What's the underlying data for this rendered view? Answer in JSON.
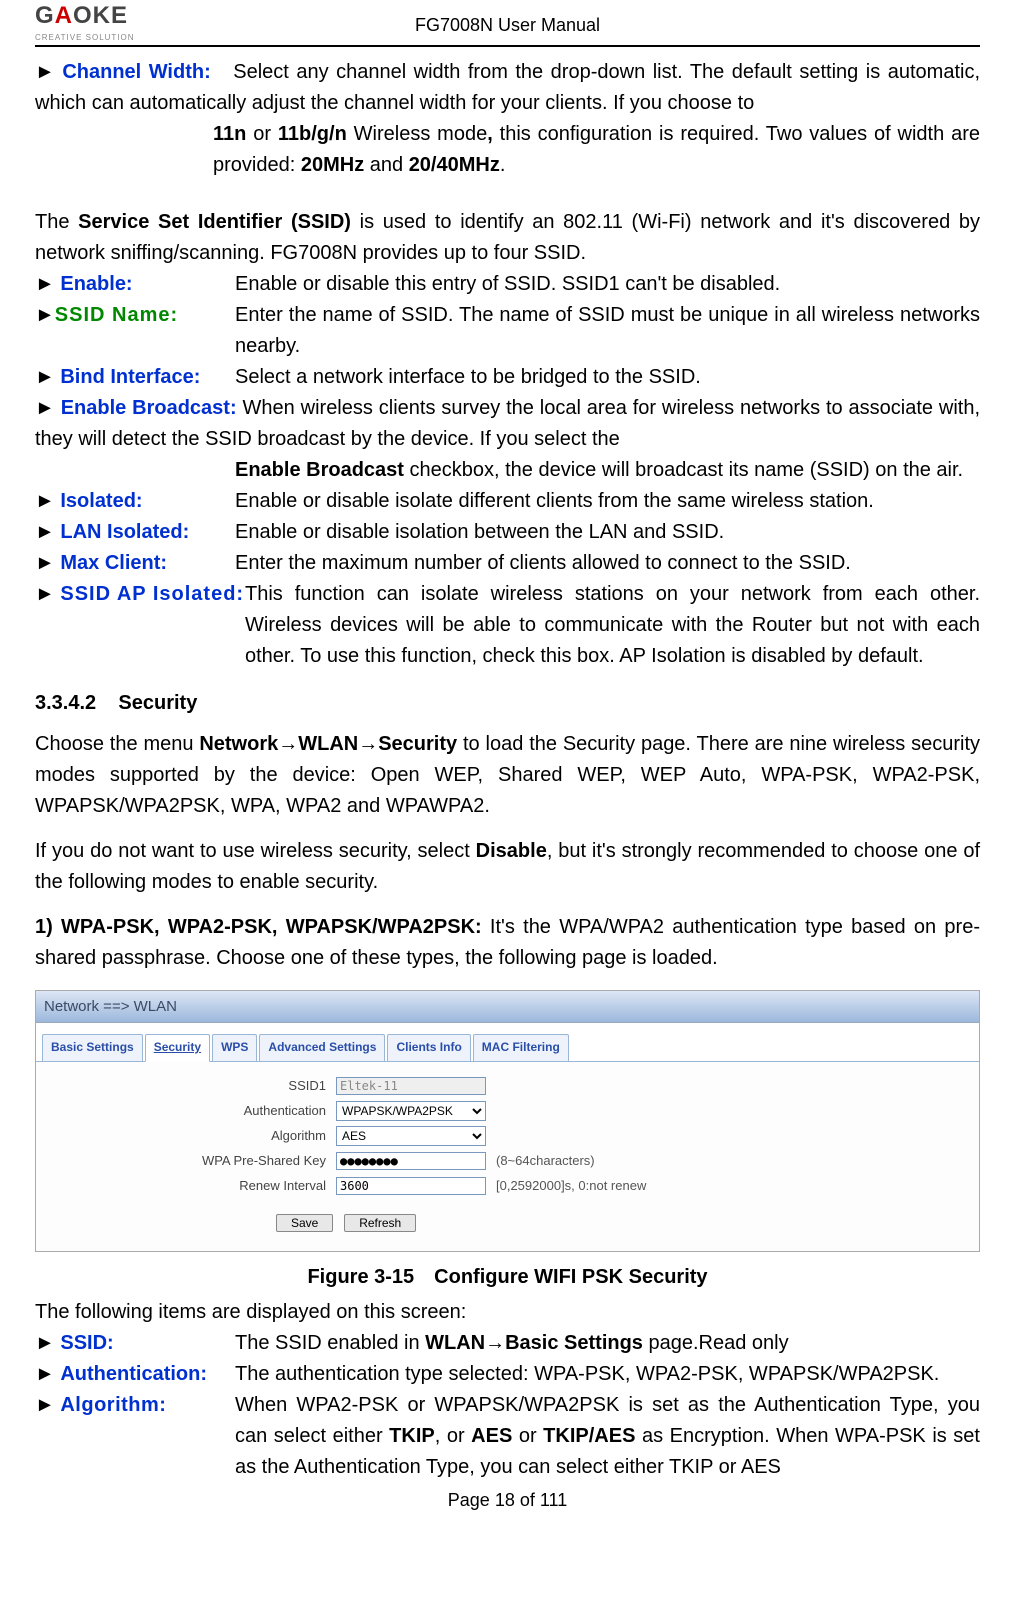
{
  "header": {
    "logo_main_pre": "G",
    "logo_main_o": "A",
    "logo_main_post": "OKE",
    "logo_sub": "CREATIVE SOLUTION",
    "doc_title": "FG7008N User Manual"
  },
  "items": {
    "channel_width": {
      "term": "Channel Width:",
      "p1": "Select any channel width from the drop-down list. The default setting is automatic, which can automatically adjust the channel width for your clients. If you choose to ",
      "bold1": "11n",
      "mid1": " or ",
      "bold2": "11b/g/n",
      "mid2": " Wireless mode",
      "bold_comma": ",",
      "mid3": " this configuration is required. Two values of width are provided: ",
      "bold3": "20MHz",
      "mid4": " and ",
      "bold4": "20/40MHz",
      "tail": "."
    }
  },
  "ssid_intro": {
    "p1": "The ",
    "bold1": "Service Set Identifier (SSID)",
    "p2": " is used to identify an 802.11 (Wi-Fi) network and it's discovered by network sniffing/scanning. FG7008N provides up to four SSID."
  },
  "ssid_items": {
    "enable": {
      "term": "Enable:",
      "desc": "Enable or disable this entry of SSID. SSID1 can't be disabled."
    },
    "ssid_name": {
      "term": "SSID Name:",
      "desc": "Enter the name of SSID. The name of SSID must be unique in all wireless networks nearby."
    },
    "bind_interface": {
      "term": "Bind Interface:",
      "desc": "Select a network interface to be bridged to the SSID."
    },
    "enable_broadcast": {
      "term": "Enable Broadcast:",
      "p1": "When wireless clients survey the local area for wireless networks to associate with, they will detect the SSID broadcast by the device. If you select the ",
      "bold1": "Enable Broadcast",
      "p2": " checkbox, the device will broadcast its name (SSID) on the air."
    },
    "isolated": {
      "term": "Isolated:",
      "desc": "Enable or disable isolate different clients from the same wireless station."
    },
    "lan_isolated": {
      "term": "LAN Isolated:",
      "desc": "Enable or disable isolation between the LAN and SSID."
    },
    "max_client": {
      "term": "Max Client:",
      "desc": "Enter the maximum number of clients allowed to connect to the SSID."
    },
    "ssid_ap_isolated": {
      "term": "SSID AP Isolated:",
      "desc": "This function can isolate wireless stations on your network from each other. Wireless devices will be able to communicate with the Router but not with each other. To use this function, check this box. AP Isolation is disabled by default."
    }
  },
  "section": {
    "num": "3.3.4.2",
    "title": "Security"
  },
  "sec_para1": {
    "p1": "Choose the menu ",
    "bold1": "Network→WLAN→Security",
    "p2": " to load the Security page. There are nine wireless security modes supported by the device: Open WEP, Shared WEP, WEP Auto, WPA-PSK, WPA2-PSK, WPAPSK/WPA2PSK, WPA, WPA2 and WPAWPA2."
  },
  "sec_para2": {
    "p1": "If you do not want to use wireless security, select ",
    "bold1": "Disable",
    "p2": ", but it's strongly recommended to choose one of the following modes to enable security."
  },
  "sec_para3": {
    "bold1": "1) WPA-PSK, WPA2-PSK, WPAPSK/WPA2PSK:",
    "p1": " It's the WPA/WPA2 authentication type based on pre-shared passphrase. Choose one of these types, the following page is loaded."
  },
  "screenshot": {
    "title": "Network ==> WLAN",
    "tabs": [
      "Basic Settings",
      "Security",
      "WPS",
      "Advanced Settings",
      "Clients Info",
      "MAC Filtering"
    ],
    "active_tab": 1,
    "fields": {
      "ssid1": {
        "label": "SSID1",
        "value": "Eltek-11"
      },
      "auth": {
        "label": "Authentication",
        "value": "WPAPSK/WPA2PSK"
      },
      "algo": {
        "label": "Algorithm",
        "value": "AES"
      },
      "key": {
        "label": "WPA Pre-Shared Key",
        "value": "●●●●●●●●",
        "hint": "(8~64characters)"
      },
      "renew": {
        "label": "Renew Interval",
        "value": "3600",
        "hint": "[0,2592000]s, 0:not renew"
      }
    },
    "buttons": {
      "save": "Save",
      "refresh": "Refresh"
    }
  },
  "figure_caption": "Figure 3-15 Configure WIFI PSK Security",
  "post_fig_intro": "The following items are displayed on this screen:",
  "post_items": {
    "ssid": {
      "term": "SSID:",
      "p1": "The SSID enabled in ",
      "bold1": "WLAN→Basic Settings",
      "p2": " page.Read only"
    },
    "authentication": {
      "term": "Authentication:",
      "desc": "The authentication type selected: WPA-PSK, WPA2-PSK, WPAPSK/WPA2PSK."
    },
    "algorithm": {
      "term": "Algorithm:",
      "p1": "When WPA2-PSK or WPAPSK/WPA2PSK is set as the Authentication Type, you can select either ",
      "b1": "TKIP",
      "m1": ", or ",
      "b2": "AES",
      "m2": " or ",
      "b3": "TKIP/AES",
      "p2": " as Encryption. When WPA-PSK is set as the Authentication Type, you can select either TKIP or AES"
    }
  },
  "footer": {
    "text": "Page 18 of 111"
  }
}
